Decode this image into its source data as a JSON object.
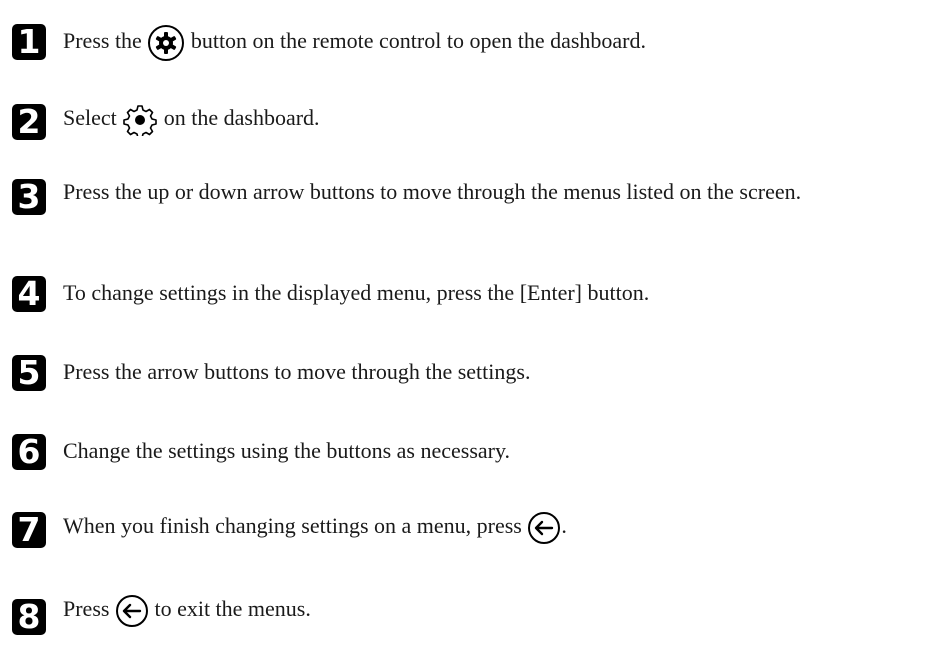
{
  "steps": [
    {
      "num": "1",
      "pre": "Press the",
      "icon": "gear-button-icon",
      "post": "button on the remote control to open the dashboard."
    },
    {
      "num": "2",
      "pre": "Select",
      "icon": "settings-cog-icon",
      "post": "on the dashboard."
    },
    {
      "num": "3",
      "text": "Press the up or down arrow buttons to move through the menus listed on the screen."
    },
    {
      "num": "4",
      "text": "To change settings in the displayed menu, press the [Enter] button."
    },
    {
      "num": "5",
      "text": "Press the arrow buttons to move through the settings."
    },
    {
      "num": "6",
      "text": "Change the settings using the buttons as necessary."
    },
    {
      "num": "7",
      "pre": "When you finish changing settings on a menu, press",
      "icon": "back-arrow-icon",
      "post": "."
    },
    {
      "num": "8",
      "pre": "Press",
      "icon": "back-arrow-icon",
      "post": "to exit the menus."
    }
  ]
}
